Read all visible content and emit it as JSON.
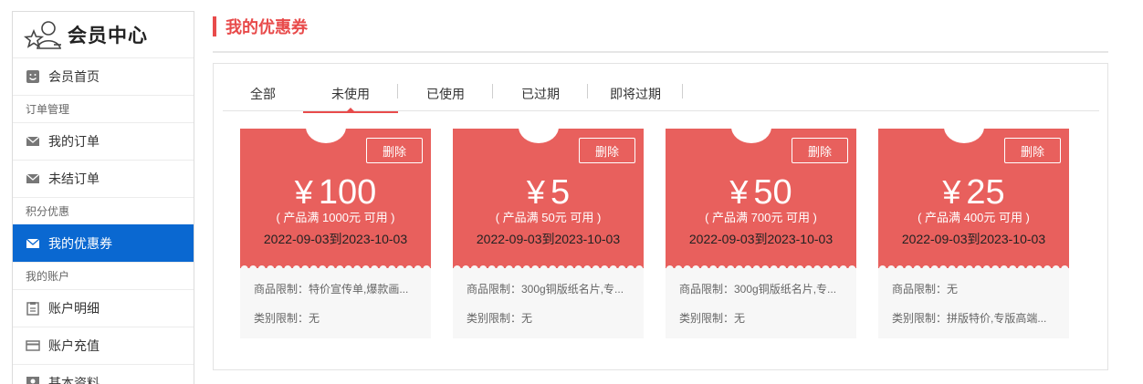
{
  "sidebar": {
    "title": "会员中心",
    "items": [
      {
        "label": "会员首页"
      },
      {
        "group": "订单管理"
      },
      {
        "label": "我的订单"
      },
      {
        "label": "未结订单"
      },
      {
        "group": "积分优惠"
      },
      {
        "label": "我的优惠券",
        "active": true
      },
      {
        "group": "我的账户"
      },
      {
        "label": "账户明细"
      },
      {
        "label": "账户充值"
      },
      {
        "label": "基本资料"
      }
    ]
  },
  "page": {
    "title": "我的优惠券"
  },
  "tabs": [
    {
      "label": "全部"
    },
    {
      "label": "未使用",
      "active": true
    },
    {
      "label": "已使用"
    },
    {
      "label": "已过期"
    },
    {
      "label": "即将过期"
    }
  ],
  "coupons": [
    {
      "delete_label": "删除",
      "currency": "¥",
      "amount": "100",
      "condition": "( 产品满 1000元 可用 )",
      "date": "2022-09-03到2023-10-03",
      "product_limit": "商品限制：特价宣传单,爆款画...",
      "category_limit": "类别限制：无"
    },
    {
      "delete_label": "删除",
      "currency": "¥",
      "amount": "5",
      "condition": "( 产品满 50元 可用 )",
      "date": "2022-09-03到2023-10-03",
      "product_limit": "商品限制：300g铜版纸名片,专...",
      "category_limit": "类别限制：无"
    },
    {
      "delete_label": "删除",
      "currency": "¥",
      "amount": "50",
      "condition": "( 产品满 700元 可用 )",
      "date": "2022-09-03到2023-10-03",
      "product_limit": "商品限制：300g铜版纸名片,专...",
      "category_limit": "类别限制：无"
    },
    {
      "delete_label": "删除",
      "currency": "¥",
      "amount": "25",
      "condition": "( 产品满 400元 可用 )",
      "date": "2022-09-03到2023-10-03",
      "product_limit": "商品限制：无",
      "category_limit": "类别限制：拼版特价,专版高端..."
    }
  ],
  "colors": {
    "accent": "#e84b4b",
    "coupon": "#e8605d",
    "active_nav": "#0a68d1"
  }
}
